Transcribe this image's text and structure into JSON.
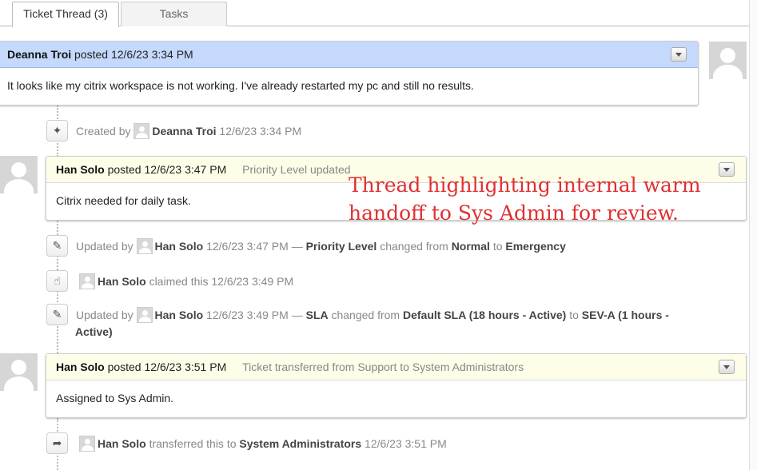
{
  "tabs": [
    {
      "label": "Ticket Thread (3)",
      "active": true
    },
    {
      "label": "Tasks",
      "active": false
    }
  ],
  "thread": {
    "message": {
      "author": "Deanna Troi",
      "verb": "posted",
      "timestamp": "12/6/23 3:34 PM",
      "body": "It looks like my citrix workspace is not working. I've already restarted my pc and still no results."
    },
    "created_event": {
      "icon": "magic-wand-icon",
      "prefix": "Created by",
      "user": "Deanna Troi",
      "timestamp": "12/6/23 3:34 PM"
    },
    "response1": {
      "author": "Han Solo",
      "verb": "posted",
      "timestamp": "12/6/23 3:47 PM",
      "note": "Priority Level updated",
      "body": "Citrix needed for daily task."
    },
    "event_priority": {
      "icon": "pencil-icon",
      "prefix": "Updated by",
      "user": "Han Solo",
      "timestamp": "12/6/23 3:47 PM",
      "dash": "—",
      "field": "Priority Level",
      "changed_from": "changed from",
      "from": "Normal",
      "to_word": "to",
      "to": "Emergency"
    },
    "event_claim": {
      "icon": "thumbs-up-icon",
      "user": "Han Solo",
      "action": "claimed this",
      "timestamp": "12/6/23 3:49 PM"
    },
    "event_sla": {
      "icon": "pencil-icon",
      "prefix": "Updated by",
      "user": "Han Solo",
      "timestamp": "12/6/23 3:49 PM",
      "dash": "—",
      "field": "SLA",
      "changed_from": "changed from",
      "from": "Default SLA (18 hours - Active)",
      "to_word": "to",
      "to_line1": "SEV-A (1 hours -",
      "to_line2": "Active)"
    },
    "response2": {
      "author": "Han Solo",
      "verb": "posted",
      "timestamp": "12/6/23 3:51 PM",
      "note": "Ticket transferred from Support to System Administrators",
      "body": "Assigned to Sys Admin."
    },
    "event_transfer": {
      "icon": "share-arrow-icon",
      "user": "Han Solo",
      "action": "transferred this to",
      "target": "System Administrators",
      "timestamp": "12/6/23 3:51 PM"
    }
  },
  "annotation": {
    "line1": "Thread highlighting internal warm",
    "line2": "handoff to Sys Admin for review.",
    "color": "#e03030"
  },
  "colors": {
    "message_header": "#c4d9fc",
    "response_header": "#fdfde8"
  }
}
